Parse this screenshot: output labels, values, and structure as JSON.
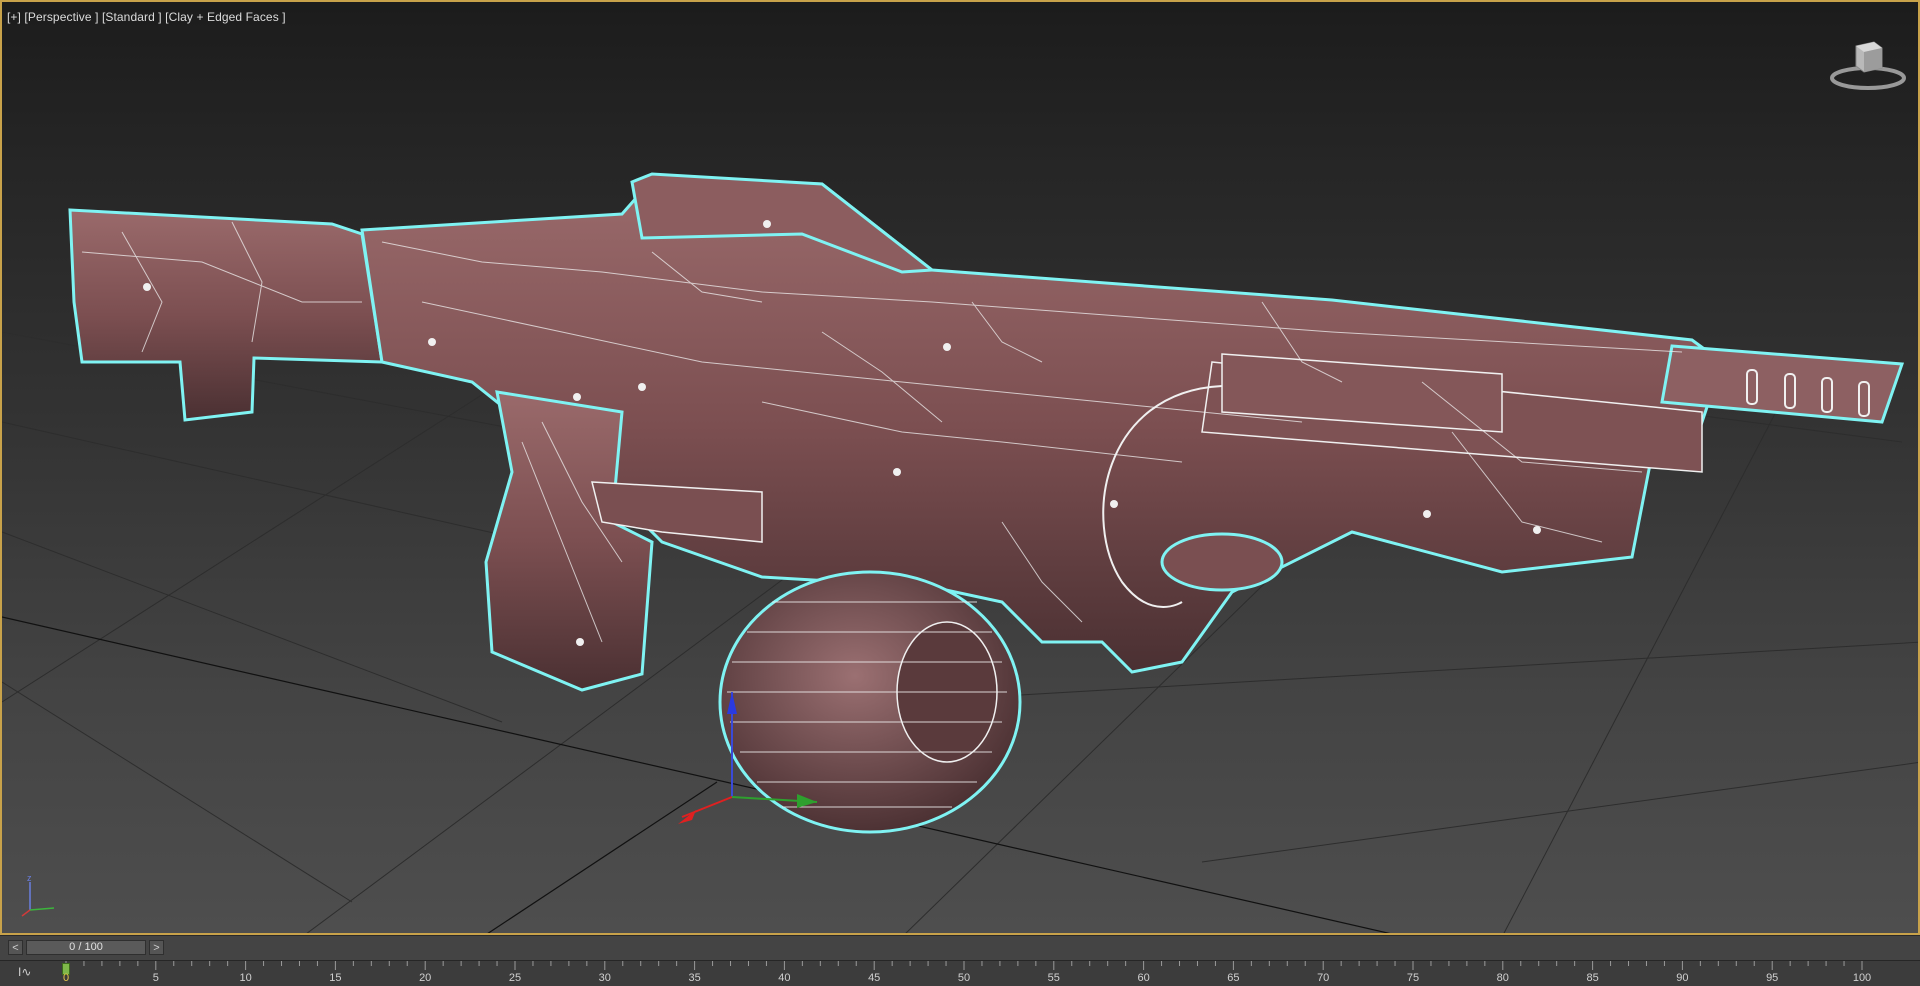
{
  "viewport": {
    "label": "[+] [Perspective ] [Standard ] [Clay + Edged Faces ]",
    "viewcube_icon": "viewcube-icon",
    "axis_icon": "axis-tripod-icon",
    "model_icon": "weapon-model-wireframe",
    "colors": {
      "border": "#c8a24a",
      "selection": "#7ff3f3",
      "clay": "#8a5a5c",
      "wire": "#f0f0f0"
    }
  },
  "timeslider": {
    "prev_label": "<",
    "next_label": ">",
    "position_text": "0 / 100"
  },
  "trackbar": {
    "icon": "curve-editor-icon",
    "icon_text": "I∿",
    "current_frame_label": "0",
    "ticks": [
      "5",
      "10",
      "15",
      "20",
      "25",
      "30",
      "35",
      "40",
      "45",
      "50",
      "55",
      "60",
      "65",
      "70",
      "75",
      "80",
      "85",
      "90",
      "95",
      "100"
    ]
  }
}
